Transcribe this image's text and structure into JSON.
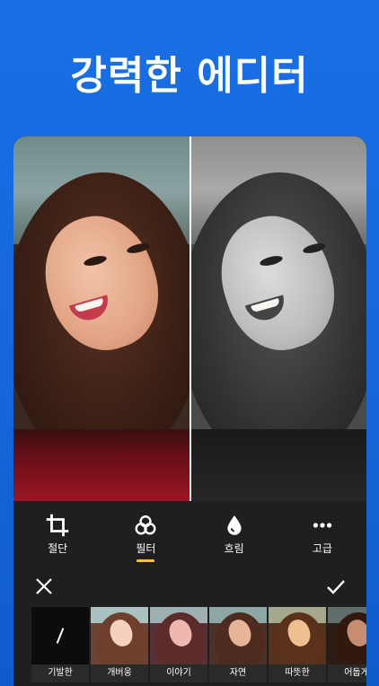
{
  "headline": "강력한 에디터",
  "tools": [
    {
      "label": "절단",
      "icon": "crop-icon",
      "active": false
    },
    {
      "label": "필터",
      "icon": "filter-icon",
      "active": true
    },
    {
      "label": "흐림",
      "icon": "blur-drop-icon",
      "active": false
    },
    {
      "label": "고급",
      "icon": "more-dots-icon",
      "active": false
    }
  ],
  "actions": {
    "close_icon": "close-icon",
    "apply_icon": "check-icon"
  },
  "filters": [
    {
      "label": "기발한",
      "style": "none"
    },
    {
      "label": "개버웅",
      "style": "warm-light"
    },
    {
      "label": "이야기",
      "style": "rose"
    },
    {
      "label": "자연",
      "style": "natural"
    },
    {
      "label": "따뜻한",
      "style": "warm"
    },
    {
      "label": "어둡게",
      "style": "dark"
    }
  ],
  "colors": {
    "background": "#1a6fe6",
    "panel": "#1f1f1f",
    "active_underline": "#f5c518",
    "text": "#ffffff"
  }
}
